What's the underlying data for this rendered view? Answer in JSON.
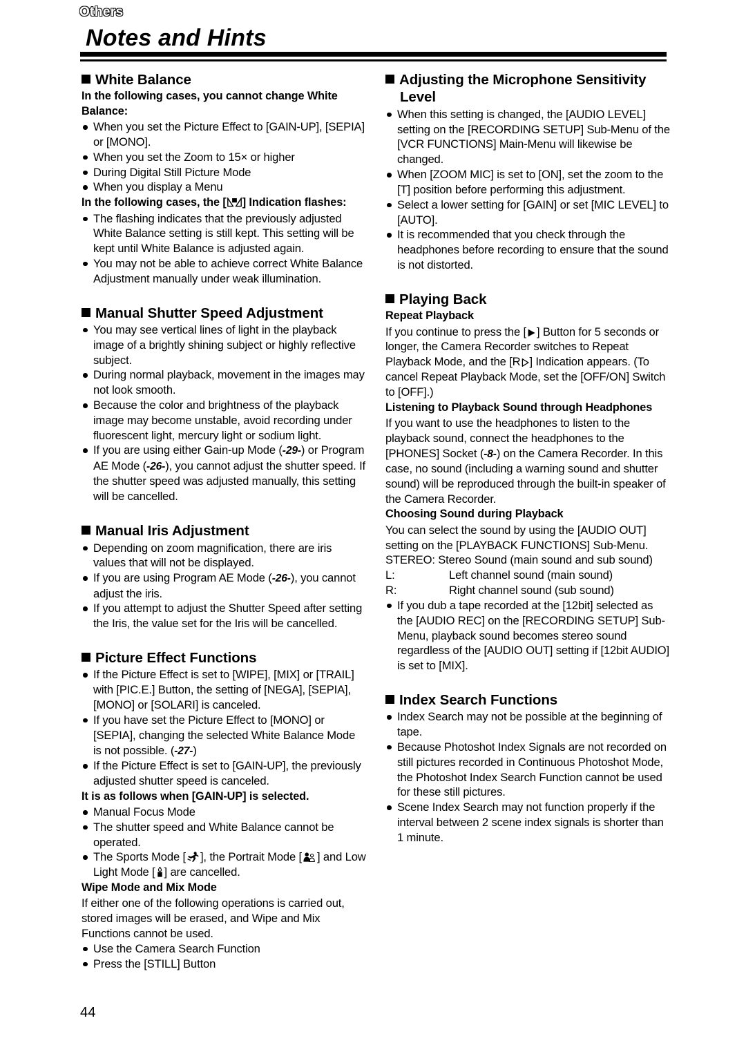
{
  "header": {
    "chapter_tab": "Others",
    "title": "Notes and Hints"
  },
  "footer": {
    "page_number": "44"
  },
  "left_column": {
    "sections": [
      {
        "heading": "White Balance",
        "lead1": "In the following cases, you cannot change White Balance:",
        "bullets1": [
          "When you set the Picture Effect to [GAIN-UP], [SEPIA] or [MONO].",
          "When you set the Zoom to 15× or higher",
          "During Digital Still Picture Mode",
          "When you display a Menu"
        ],
        "lead2_before": "In the following cases, the [",
        "lead2_after": "] Indication flashes:",
        "bullets2": [
          "The flashing indicates that the previously adjusted White Balance setting is still kept. This setting will be kept until White Balance is adjusted again.",
          "You may not be able to achieve correct White Balance Adjustment manually under weak illumination."
        ]
      },
      {
        "heading": "Manual Shutter Speed Adjustment",
        "bullets": [
          "You may see vertical lines of light in the playback image of a brightly shining subject or highly reflective subject.",
          "During normal playback, movement in the images may not look smooth.",
          "Because the color and brightness of the playback image may become unstable, avoid recording under fluorescent light, mercury light or sodium light."
        ],
        "bullet_pageref": {
          "part1": "If you are using either Gain-up Mode (",
          "ref1": "-29-",
          "part2": ") or Program AE Mode (",
          "ref2": "-26-",
          "part3": "), you cannot adjust the shutter speed. If the shutter speed was adjusted manually, this setting will be cancelled."
        }
      },
      {
        "heading": "Manual Iris Adjustment",
        "bullet1": "Depending on zoom magnification, there are iris values that will not be displayed.",
        "bullet2": {
          "part1": "If you are using Program AE Mode (",
          "ref1": "-26-",
          "part2": "), you cannot adjust the iris."
        },
        "bullet3": "If you attempt to adjust the Shutter Speed after setting the Iris, the value set for the Iris will be cancelled."
      },
      {
        "heading": "Picture Effect Functions",
        "bullet1": "If the Picture Effect is set to [WIPE], [MIX] or [TRAIL] with [PIC.E.] Button, the setting of [NEGA], [SEPIA], [MONO] or [SOLARI] is canceled.",
        "bullet2": {
          "part1": "If you have set the Picture Effect to [MONO] or [SEPIA], changing the selected White Balance Mode is not possible. (",
          "ref1": "-27-",
          "part2": ")"
        },
        "bullet3": "If the Picture Effect is set to [GAIN-UP], the previously adjusted shutter speed is canceled.",
        "lead_gainup": "It is as follows when [GAIN-UP] is selected.",
        "bullets_gainup_1": "Manual Focus Mode",
        "bullets_gainup_2": "The shutter speed and White Balance cannot be operated.",
        "bullets_gainup_3": {
          "part1": "The Sports Mode [",
          "part2": "], the Portrait Mode [",
          "part3": "] and Low Light Mode [",
          "part4": "] are cancelled."
        },
        "lead_wipe": "Wipe Mode and Mix Mode",
        "para_wipe": "If either one of the following operations is carried out, stored images will be erased, and Wipe and Mix Functions cannot be used.",
        "bullets_wipe": [
          "Use the Camera Search Function",
          "Press the [STILL] Button"
        ]
      }
    ]
  },
  "right_column": {
    "sections": [
      {
        "heading_line1": "Adjusting the Microphone Sensitivity",
        "heading_line2": "Level",
        "bullets": [
          "When this setting is changed, the [AUDIO LEVEL] setting on the [RECORDING SETUP] Sub-Menu of the [VCR FUNCTIONS] Main-Menu will likewise be changed.",
          "When [ZOOM MIC] is set to [ON], set the zoom to the [T] position before performing this adjustment.",
          "Select a lower setting for [GAIN] or set [MIC LEVEL] to [AUTO].",
          "It is recommended that you check through the headphones before recording to ensure that the sound is not distorted."
        ]
      },
      {
        "heading": "Playing Back",
        "sub1_title": "Repeat Playback",
        "sub1_para_a": "If you continue to press the [",
        "sub1_para_b": "] Button for 5 seconds or longer, the Camera Recorder switches to Repeat Playback Mode, and the [R",
        "sub1_para_c": "] Indication appears. (To cancel Repeat Playback Mode, set the [OFF/ON] Switch to [OFF].)",
        "sub2_title": "Listening to Playback Sound through Headphones",
        "sub2_para_a": "If you want to use the headphones to listen to the playback sound, connect the headphones to the [PHONES] Socket (",
        "sub2_ref": "-8-",
        "sub2_para_b": ") on the Camera Recorder. In this case, no sound (including a warning sound and shutter sound) will be reproduced through the built-in speaker of the Camera Recorder.",
        "sub3_title": "Choosing Sound during Playback",
        "sub3_para": "You can select the sound by using the [AUDIO OUT] setting on the [PLAYBACK FUNCTIONS] Sub-Menu.",
        "sub3_stereo": "STEREO: Stereo Sound (main sound and sub sound)",
        "sub3_channels": [
          {
            "key": "L:",
            "value": "Left channel sound (main sound)"
          },
          {
            "key": "R:",
            "value": "Right channel sound (sub sound)"
          }
        ],
        "sub3_bullet": "If you dub a tape recorded at the [12bit] selected as the [AUDIO REC] on the [RECORDING SETUP] Sub-Menu, playback sound becomes stereo sound regardless of the [AUDIO OUT] setting if [12bit AUDIO] is set to [MIX]."
      },
      {
        "heading": "Index Search Functions",
        "bullets": [
          "Index Search may not be possible at the beginning of tape.",
          "Because Photoshot Index Signals are not recorded on still pictures recorded in Continuous Photoshot Mode, the Photoshot Index Search Function cannot be used for these still pictures.",
          "Scene Index Search may not function properly if the interval between 2 scene index signals is shorter than 1 minute."
        ]
      }
    ]
  },
  "icons": {
    "white_balance": "white-balance-icon",
    "sports_mode": "sports-mode-icon",
    "portrait_mode": "portrait-mode-icon",
    "low_light_mode": "low-light-mode-icon",
    "play_button": "play-icon",
    "repeat_play": "repeat-play-icon"
  },
  "colors": {
    "text": "#000000",
    "background": "#ffffff"
  }
}
